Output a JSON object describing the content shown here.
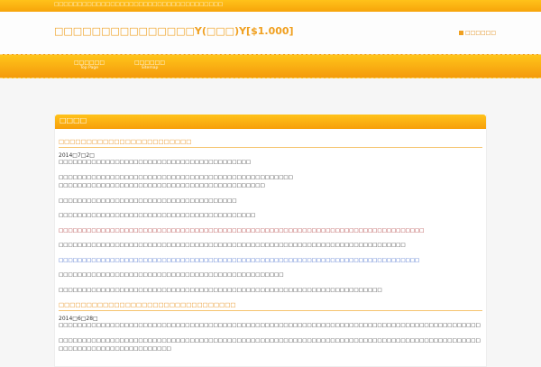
{
  "topbar": {
    "text": "□□□□□□□□□□□□□□□□□□□□□□□□□□□□□□□□□□□□"
  },
  "header": {
    "title": "□□□□□□□□□□□□□□□Y(□□□)Y[$1.000]",
    "link": "□□□□□□"
  },
  "nav": [
    {
      "label": "□□□□□□",
      "sub": "Top Page"
    },
    {
      "label": "□□□□□□",
      "sub": "Sitemap"
    }
  ],
  "box": {
    "heading": "□□□□"
  },
  "posts": [
    {
      "title": "□□□□□□□□□□□□□□□□□□□□□□□□",
      "date": "2014□7□2□",
      "paragraphs": [
        "□□□□□□□□□□□□□□□□□□□□□□□□□□□□□□□□□□□□□□□□□",
        "□□□□□□□□□□□□□□□□□□□□□□□□□□□□□□□□□□□□□□□□□□□□□□□□□□",
        "□□□□□□□□□□□□□□□□□□□□□□□□□□□□□□□□□□□□□□□□□□□□",
        "□□□□□□□□□□□□□□□□□□□□□□□□□□□□□□□□□□□□□□",
        "□□□□□□□□□□□□□□□□□□□□□□□□□□□□□□□□□□□□□□□□□□",
        "□□□□□□□□□□□□□□□□□□□□□□□□□□□□□□□□□□□□□□□□□□□□□□□□□□□□□□□□□□□□□□□□□□□□□□□□□□□□□□",
        "□□□□□□□□□□□□□□□□□□□□□□□□□□□□□□□□□□□□□□□□□□□□□□□□□□□□□□□□□□□□□□□□□□□□□□□□□□",
        "□□□□□□□□□□□□□□□□□□□□□□□□□□□□□□□□□□□□□□□□□□□□□□□□□□□□□□□□□□□□□□□□□□□□□□□□□□□□□",
        "□□□□□□□□□□□□□□□□□□□□□□□□□□□□□□□□□□□□□□□□□□□□□□□□",
        "□□□□□□□□□□□□□□□□□□□□□□□□□□□□□□□□□□□□□□□□□□□□□□□□□□□□□□□□□□□□□□□□□□□□□"
      ]
    },
    {
      "title": "□□□□□□□□□□□□□□□□□□□□□□□□□□□□□□□□",
      "date": "2014□6□28□",
      "paragraphs": [
        "□□□□□□□□□□□□□□□□□□□□□□□□□□□□□□□□□□□□□□□□□□□□□□□□□□□□□□□□□□□□□□□□□□□□□□□□□□□□□□□□□□□□□□□□□□",
        "□□□□□□□□□□□□□□□□□□□□□□□□□□□□□□□□□□□□□□□□□□□□□□□□□□□□□□□□□□□□□□□□□□□□□□□□□□□□□□□□□□□□□□□□□□□□□□□□□□□□□□□□□□□□□□□□□□"
      ]
    }
  ]
}
